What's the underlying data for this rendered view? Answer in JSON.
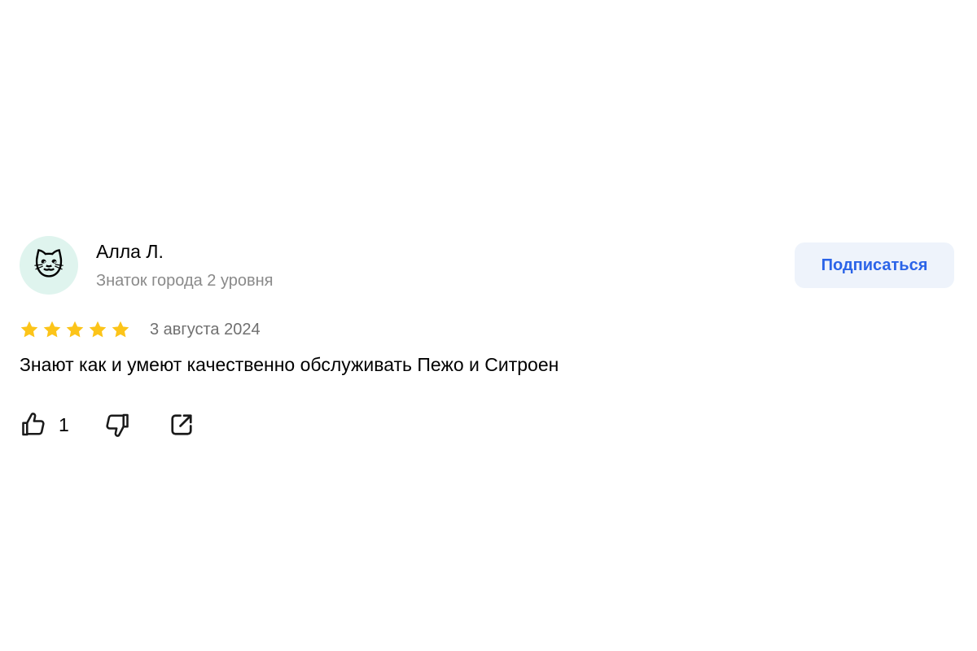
{
  "review": {
    "author": {
      "name": "Алла Л.",
      "level": "Знаток города 2 уровня",
      "avatar_icon": "cat-face-emoji",
      "avatar_glyph": "🐱",
      "avatar_bg": "#dff4ee"
    },
    "subscribe_label": "Подписаться",
    "rating": 5,
    "rating_max": 5,
    "star_color": "#fcc419",
    "date": "3 августа 2024",
    "text": "Знают как и умеют качественно обслуживать Пежо и Ситроен",
    "actions": {
      "like_icon": "thumbs-up-icon",
      "like_count": "1",
      "dislike_icon": "thumbs-down-icon",
      "share_icon": "share-icon"
    },
    "accent_color": "#2b64e8"
  }
}
